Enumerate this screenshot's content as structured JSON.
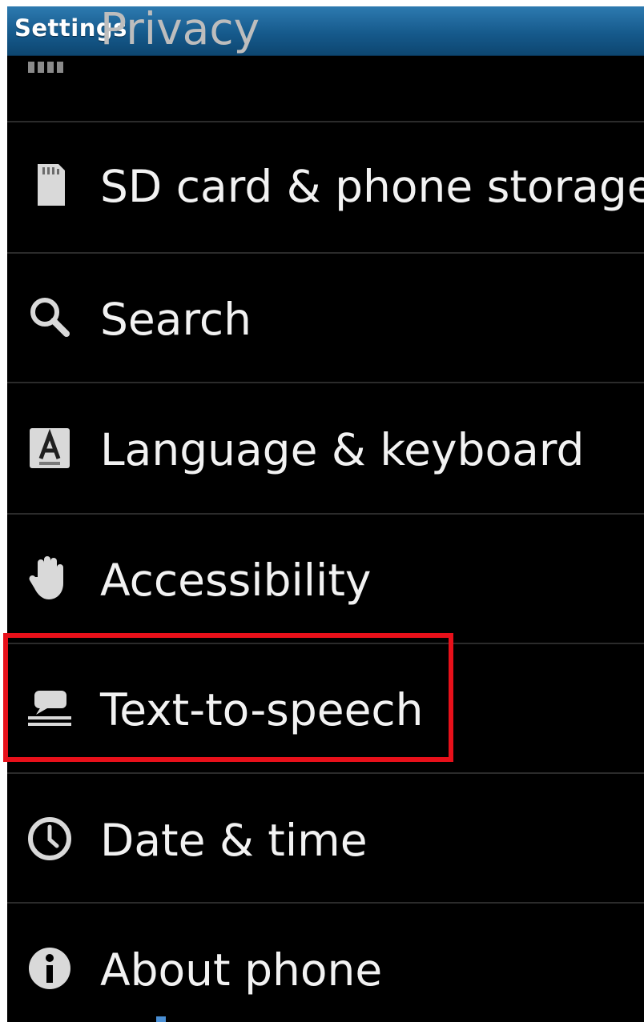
{
  "app": {
    "title": "Settings"
  },
  "settings_list": {
    "items": [
      {
        "label": "Privacy",
        "icon": "privacy-icon"
      },
      {
        "label": "SD card & phone storage",
        "icon": "sd-card-icon"
      },
      {
        "label": "Search",
        "icon": "search-icon"
      },
      {
        "label": "Language & keyboard",
        "icon": "language-keyboard-icon"
      },
      {
        "label": "Accessibility",
        "icon": "hand-icon"
      },
      {
        "label": "Text-to-speech",
        "icon": "speech-bubble-icon"
      },
      {
        "label": "Date & time",
        "icon": "clock-icon"
      },
      {
        "label": "About phone",
        "icon": "info-icon"
      }
    ],
    "highlighted_item": "Text-to-speech"
  },
  "colors": {
    "titlebar": "#165a8c",
    "background": "#000000",
    "text": "#f2f2f2",
    "highlight_border": "#e8101a"
  }
}
